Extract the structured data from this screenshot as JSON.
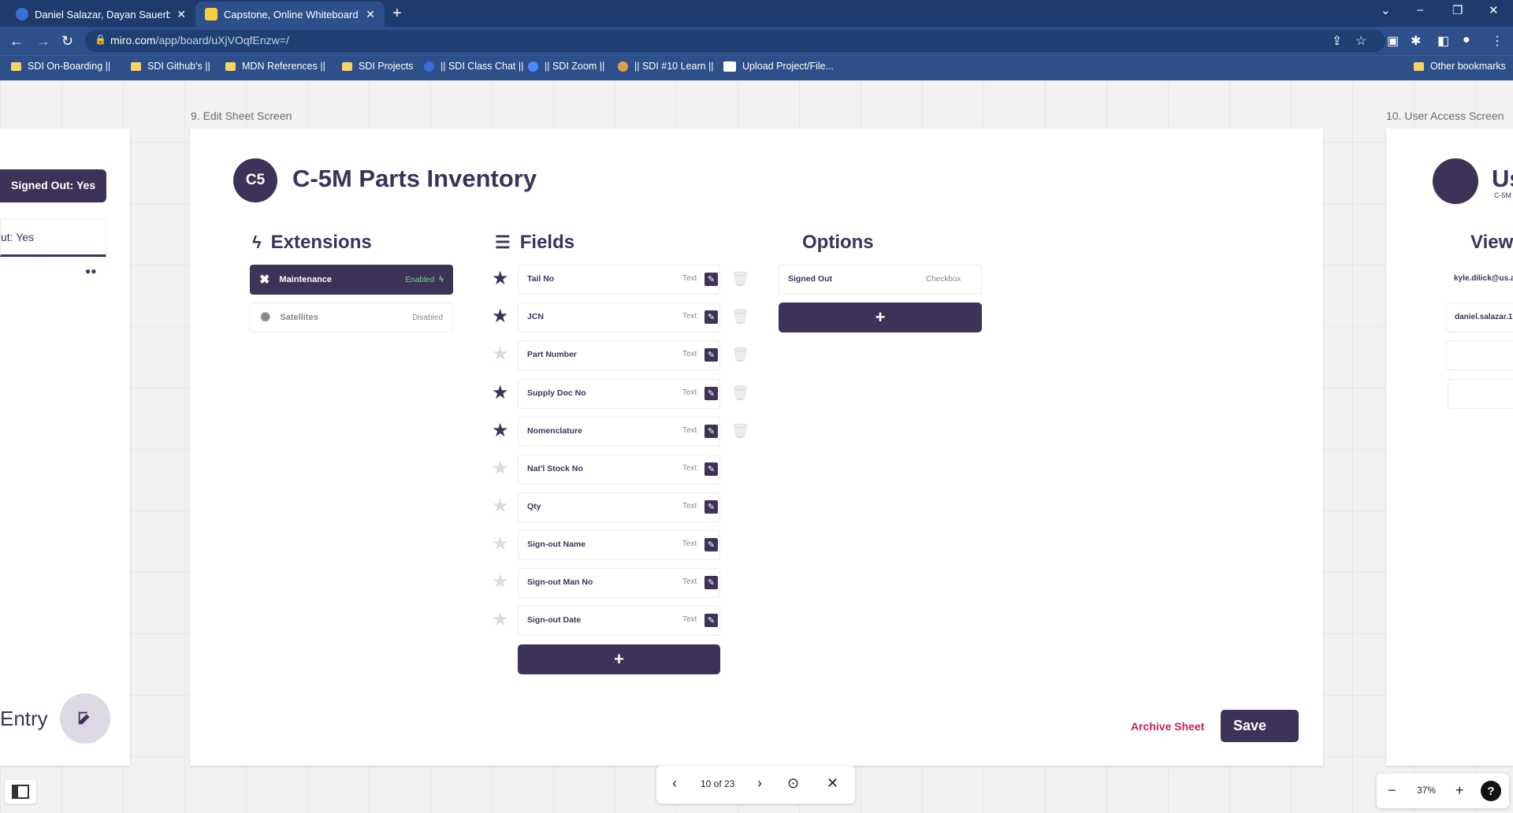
{
  "browser": {
    "tabs": [
      {
        "title": "Daniel Salazar, Dayan Sauerbronn"
      },
      {
        "title": "Capstone, Online Whiteboard for"
      }
    ],
    "url_host": "miro.com",
    "url_path": "/app/board/uXjVOqfEnzw=/",
    "bookmarks": [
      "SDI On-Boarding ||",
      "SDI Github's ||",
      "MDN References ||",
      "SDI Projects",
      "|| SDI Class Chat ||",
      "|| SDI Zoom ||",
      "|| SDI #10 Learn ||",
      "Upload Project/File...",
      "Other bookmarks"
    ]
  },
  "board": {
    "left_frame": {
      "pill": "Signed Out: Yes",
      "item": "ut: Yes",
      "entry": "Entry"
    },
    "main_frame": {
      "label": "9. Edit Sheet Screen",
      "badge": "C5",
      "title": "C-5M Parts Inventory",
      "extensions_heading": "Extensions",
      "fields_heading": "Fields",
      "options_heading": "Options",
      "extensions": [
        {
          "name": "Maintenance",
          "status": "Enabled",
          "enabled": true
        },
        {
          "name": "Satellites",
          "status": "Disabled",
          "enabled": false
        }
      ],
      "fields": [
        {
          "name": "Tail No",
          "type": "Text",
          "starred": true,
          "deletable": true
        },
        {
          "name": "JCN",
          "type": "Text",
          "starred": true,
          "deletable": true
        },
        {
          "name": "Part Number",
          "type": "Text",
          "starred": false,
          "deletable": true
        },
        {
          "name": "Supply Doc No",
          "type": "Text",
          "starred": true,
          "deletable": true
        },
        {
          "name": "Nomenclature",
          "type": "Text",
          "starred": true,
          "deletable": true
        },
        {
          "name": "Nat'l Stock No",
          "type": "Text",
          "starred": false,
          "deletable": false
        },
        {
          "name": "Qty",
          "type": "Text",
          "starred": false,
          "deletable": false
        },
        {
          "name": "Sign-out Name",
          "type": "Text",
          "starred": false,
          "deletable": false
        },
        {
          "name": "Sign-out Man No",
          "type": "Text",
          "starred": false,
          "deletable": false
        },
        {
          "name": "Sign-out Date",
          "type": "Text",
          "starred": false,
          "deletable": false
        }
      ],
      "options": [
        {
          "name": "Signed Out",
          "type": "Checkbox"
        }
      ],
      "add_symbol": "+",
      "archive_label": "Archive Sheet",
      "save_label": "Save"
    },
    "right_frame": {
      "label": "10. User Access Screen",
      "title": "Us",
      "subtitle": "C-5M",
      "heading": "View",
      "users": [
        "kyle.dilick@us.a",
        "daniel.salazar.1"
      ]
    }
  },
  "presentation": {
    "counter": "10 of 23"
  },
  "zoom": {
    "level": "37%",
    "help": "?"
  },
  "colors": {
    "primary": "#3d3358",
    "accent": "#c0245a",
    "chrome": "#2d4f8a"
  }
}
